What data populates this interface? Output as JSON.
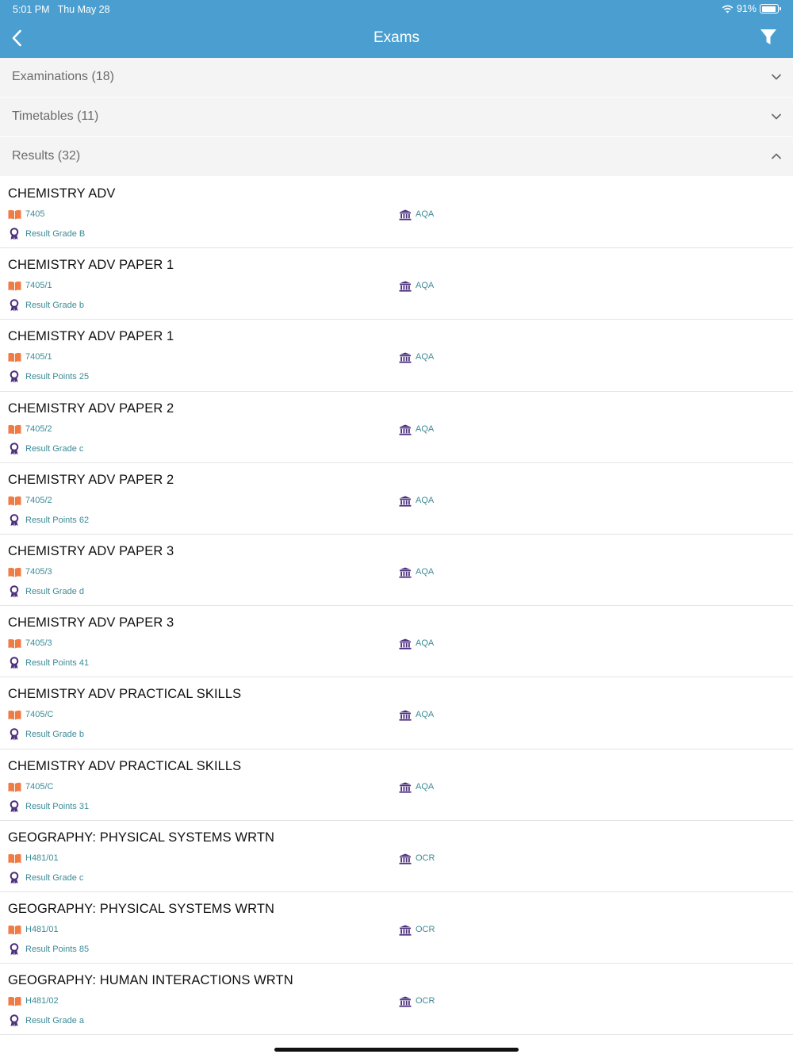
{
  "status": {
    "time": "5:01 PM",
    "date": "Thu May 28",
    "battery": "91%",
    "battery_level": 0.91
  },
  "nav": {
    "title": "Exams",
    "back_icon": "chevron-left-icon",
    "filter_icon": "filter-icon"
  },
  "sections": {
    "examinations": "Examinations (18)",
    "timetables": "Timetables (11)",
    "results": "Results (32)"
  },
  "colors": {
    "header": "#4a9fd0",
    "accent_text": "#3c8b96",
    "book_icon": "#ef7b45",
    "board_icon": "#4b2f7d",
    "result_icon": "#4b2f7d"
  },
  "results": [
    {
      "title": "CHEMISTRY ADV",
      "code": "7405",
      "board": "AQA",
      "result": "Result Grade B"
    },
    {
      "title": "CHEMISTRY ADV PAPER 1",
      "code": "7405/1",
      "board": "AQA",
      "result": "Result Grade b"
    },
    {
      "title": "CHEMISTRY ADV PAPER 1",
      "code": "7405/1",
      "board": "AQA",
      "result": "Result Points 25"
    },
    {
      "title": "CHEMISTRY ADV PAPER 2",
      "code": "7405/2",
      "board": "AQA",
      "result": "Result Grade c"
    },
    {
      "title": "CHEMISTRY ADV PAPER 2",
      "code": "7405/2",
      "board": "AQA",
      "result": "Result Points 62"
    },
    {
      "title": "CHEMISTRY ADV PAPER 3",
      "code": "7405/3",
      "board": "AQA",
      "result": "Result Grade d"
    },
    {
      "title": "CHEMISTRY ADV PAPER 3",
      "code": "7405/3",
      "board": "AQA",
      "result": "Result Points 41"
    },
    {
      "title": "CHEMISTRY ADV PRACTICAL SKILLS",
      "code": "7405/C",
      "board": "AQA",
      "result": "Result Grade b"
    },
    {
      "title": "CHEMISTRY ADV PRACTICAL SKILLS",
      "code": "7405/C",
      "board": "AQA",
      "result": "Result Points 31"
    },
    {
      "title": "GEOGRAPHY: PHYSICAL SYSTEMS WRTN",
      "code": "H481/01",
      "board": "OCR",
      "result": "Result Grade c"
    },
    {
      "title": "GEOGRAPHY: PHYSICAL SYSTEMS WRTN",
      "code": "H481/01",
      "board": "OCR",
      "result": "Result Points 85"
    },
    {
      "title": "GEOGRAPHY: HUMAN INTERACTIONS WRTN",
      "code": "H481/02",
      "board": "OCR",
      "result": "Result Grade a"
    }
  ]
}
